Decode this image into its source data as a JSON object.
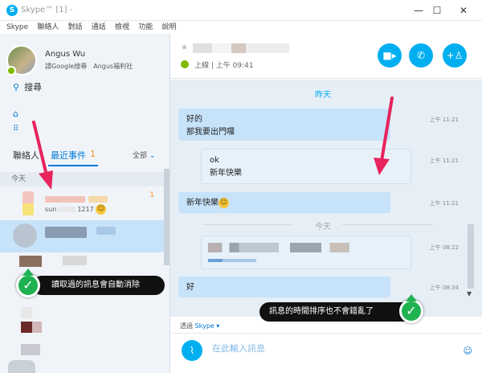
{
  "window": {
    "title": "Skype™ [1] -",
    "app_icon": "S",
    "minimize": "—",
    "maximize": "☐",
    "close": "✕"
  },
  "menu": [
    "Skype",
    "聯絡人",
    "對話",
    "通話",
    "檢視",
    "功能",
    "說明"
  ],
  "profile": {
    "name": "Angus Wu",
    "mood": "請Google搜尋　Angus福利社"
  },
  "sidebar": {
    "search_label": "搜尋",
    "tab_contacts": "聯絡人",
    "tab_recent": "最近事件",
    "recent_count": "1",
    "filter": "全部",
    "today": "今天",
    "first_contact": {
      "count": "1",
      "preview": "sun",
      "preview_tail": "1217"
    }
  },
  "chat": {
    "status": "上線  |  上午 09:41",
    "yesterday": "昨天",
    "today": "今天",
    "messages": [
      {
        "lines": [
          "好的",
          "那我要出門囉"
        ],
        "time": "上午 11:21"
      },
      {
        "lines": [
          "ok",
          "新年快樂"
        ],
        "time": "上午 11:21"
      },
      {
        "lines": [
          "新年快樂"
        ],
        "time": "上午 11:21"
      },
      {
        "time": "上午 08:22"
      },
      {
        "lines": [
          "好"
        ],
        "time": "上午 08:34"
      }
    ],
    "via_label": "透過",
    "via_service": "Skype",
    "input_placeholder": "在此輸入訊息"
  },
  "annotations": {
    "left": "讀取過的訊息會自動消除",
    "right": "訊息的時間排序也不會錯亂了"
  },
  "colors": {
    "skype_blue": "#00aff0",
    "accent": "#0078d7",
    "online_green": "#7fba00",
    "arrow_pink": "#e8245c",
    "check_green": "#1fb251",
    "bubble_blue": "#c7e3fa"
  }
}
